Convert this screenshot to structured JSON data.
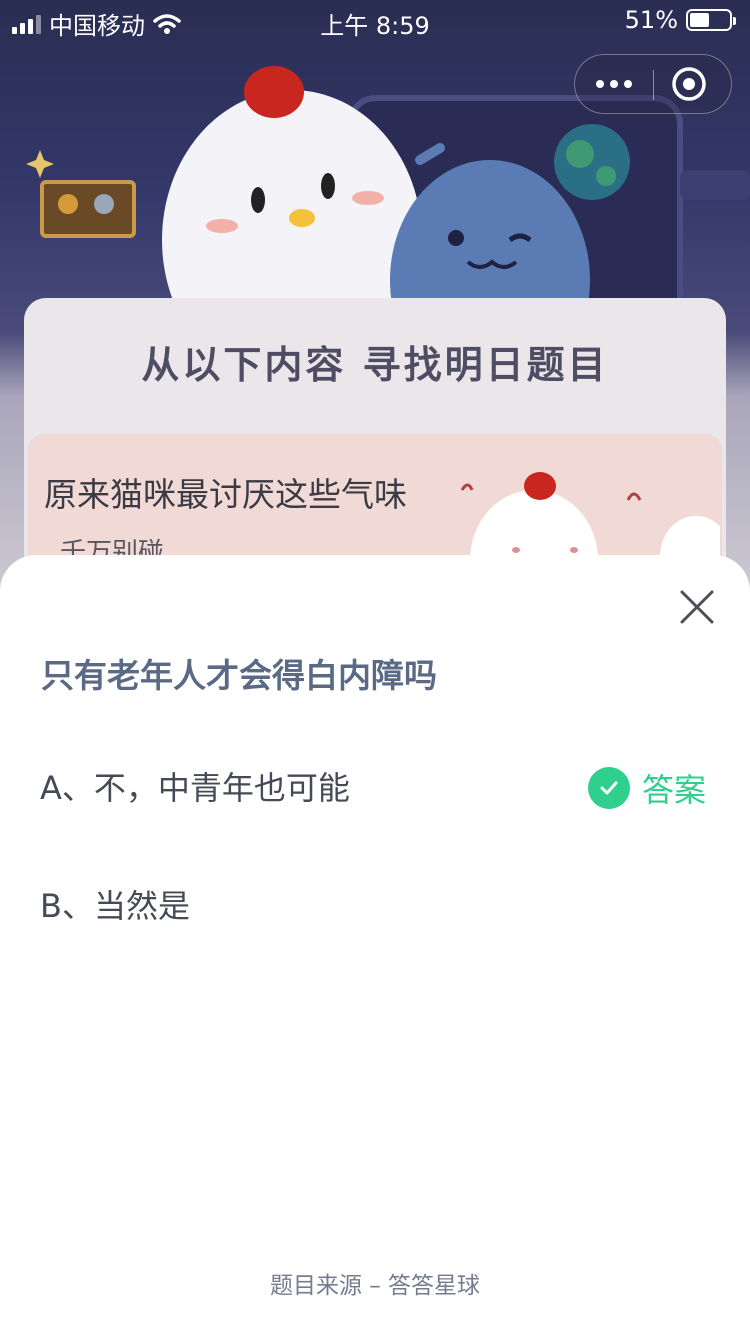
{
  "status_bar": {
    "carrier": "中国移动",
    "time": "上午 8:59",
    "battery_percent": "51%",
    "battery_level": 0.51
  },
  "mini_program": {
    "more_icon": "more-dots-icon",
    "close_icon": "close-circle-icon"
  },
  "background": {
    "heading": "从以下内容  寻找明日题目",
    "article_title": "原来猫咪最讨厌这些气味",
    "article_subtitle": "千万别碰"
  },
  "quiz": {
    "question": "只有老年人才会得白内障吗",
    "options": [
      {
        "label": "A、不，中青年也可能",
        "correct": true
      },
      {
        "label": "B、当然是",
        "correct": false
      }
    ],
    "answer_label": "答案",
    "accent_color": "#2fcf8e",
    "footer": "题目来源 – 答答星球"
  }
}
